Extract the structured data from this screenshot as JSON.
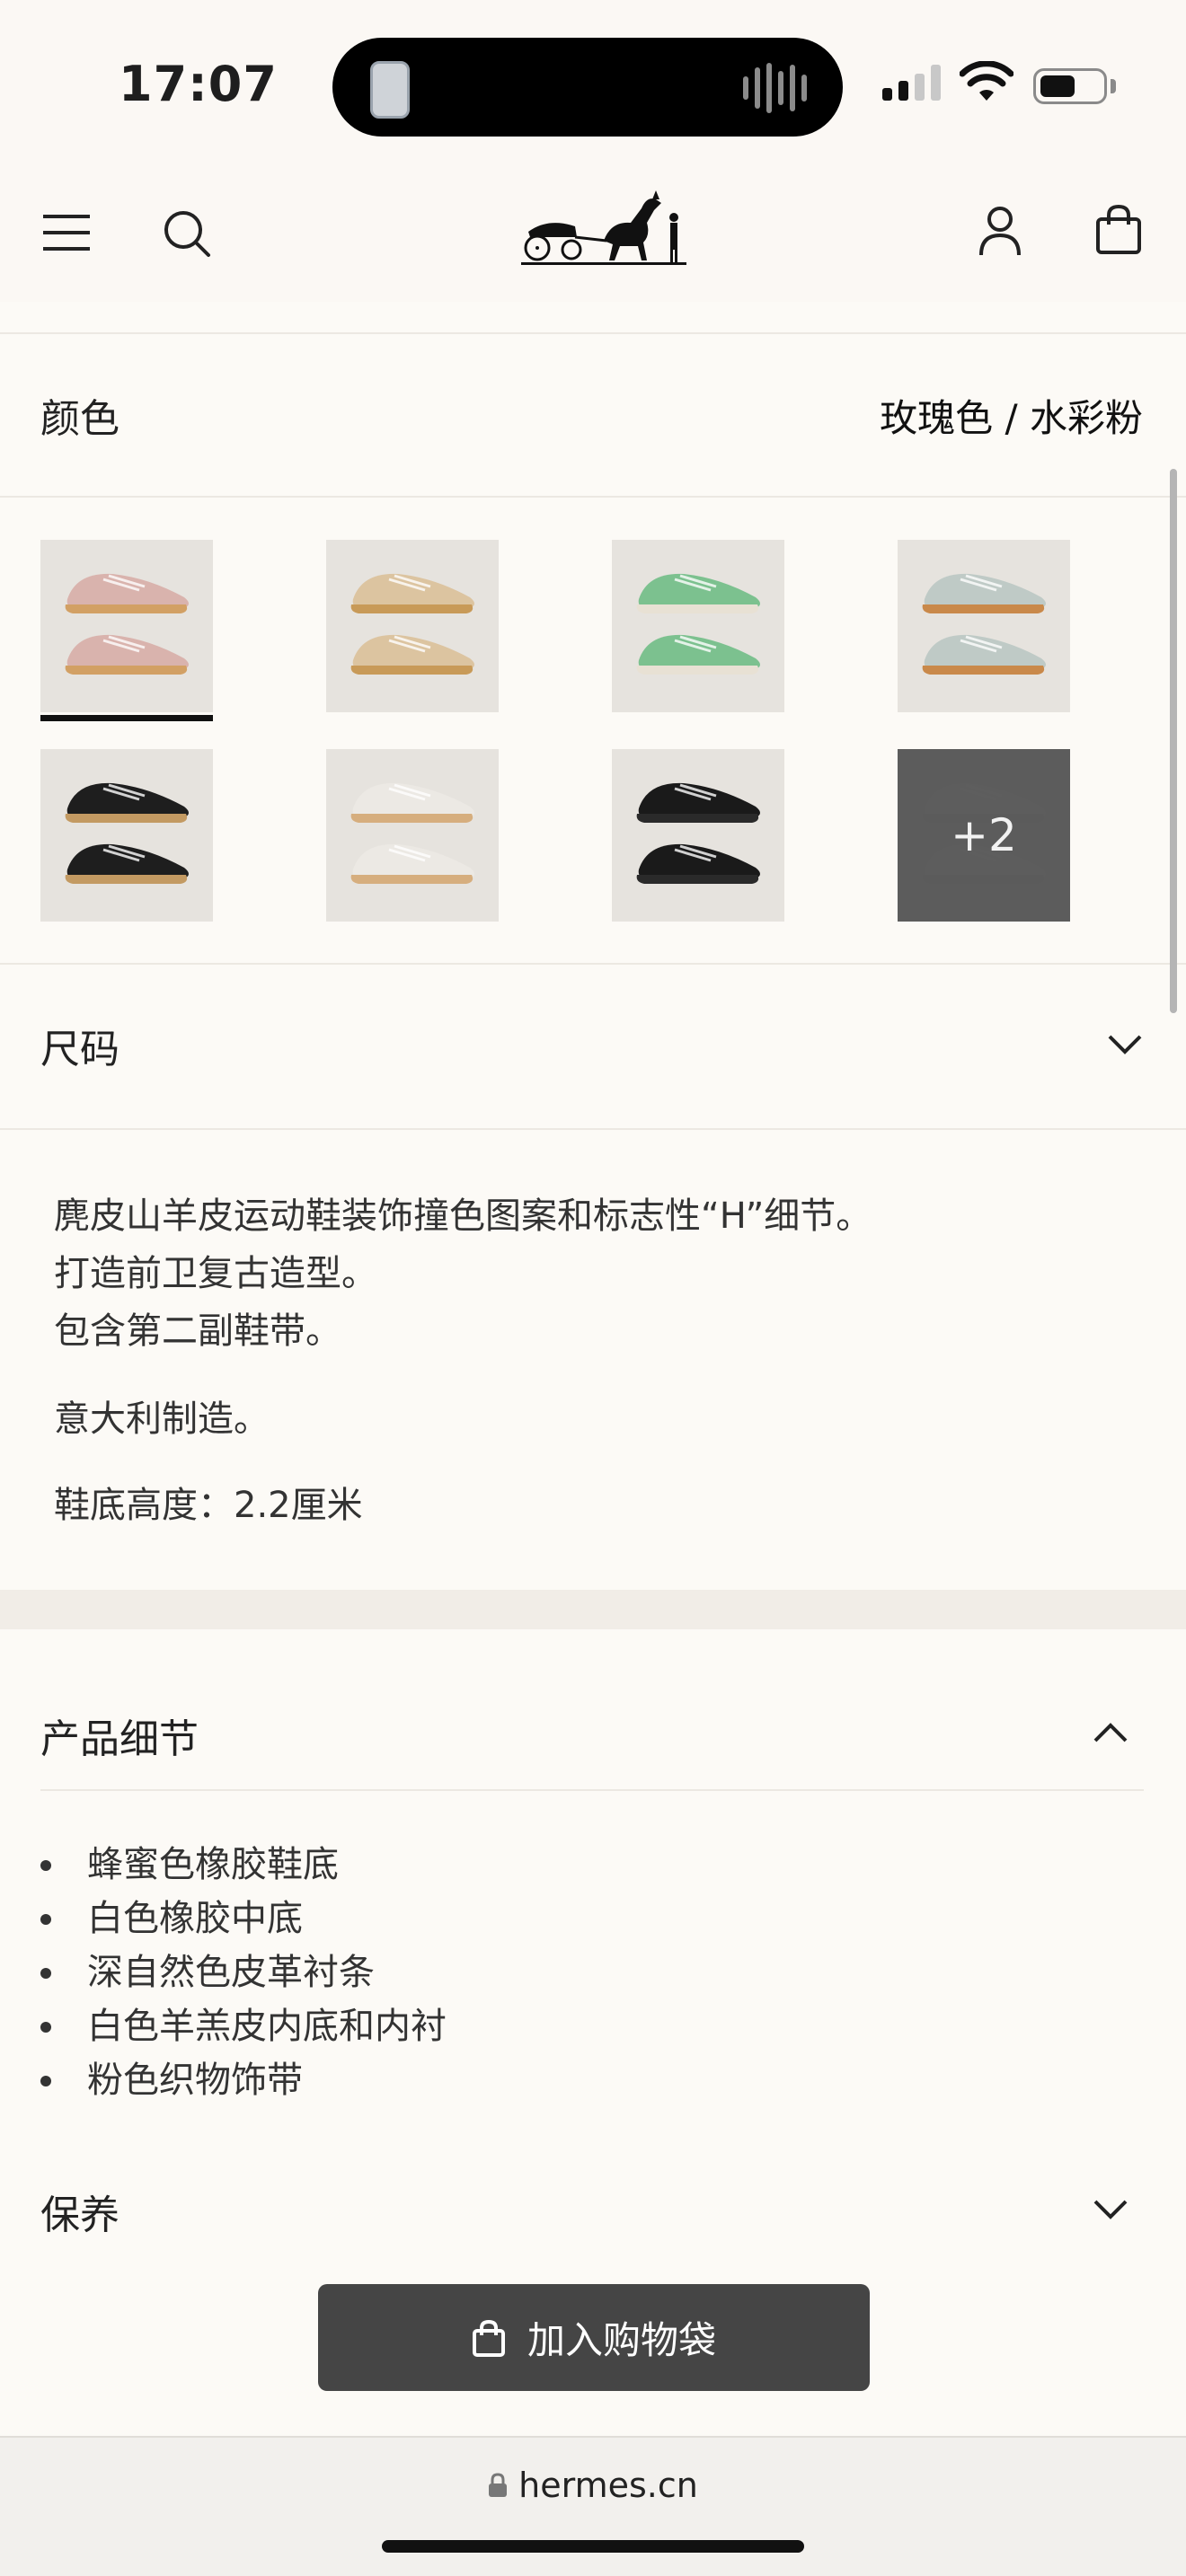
{
  "status_bar": {
    "time": "17:07"
  },
  "header": {
    "menu_icon": "hamburger-menu-icon",
    "search_icon": "search-icon",
    "logo": "hermes-carriage-logo",
    "account_icon": "account-icon",
    "bag_icon": "shopping-bag-icon"
  },
  "color": {
    "label": "颜色",
    "selected_value": "玫瑰色 / 水彩粉",
    "more_count": "+2",
    "swatches": [
      {
        "name": "rose",
        "upper": "#d9b3ad",
        "sole": "#d2a064"
      },
      {
        "name": "beige",
        "upper": "#dcc4a0",
        "sole": "#c89a58"
      },
      {
        "name": "green",
        "upper": "#7cc18f",
        "sole": "#e8e1d4"
      },
      {
        "name": "grey-green",
        "upper": "#bfcac6",
        "sole": "#c9894a"
      },
      {
        "name": "black",
        "upper": "#1e1e1e",
        "sole": "#c39a62"
      },
      {
        "name": "white",
        "upper": "#ece9e4",
        "sole": "#d6ae7e"
      },
      {
        "name": "black-black",
        "upper": "#1a1a1a",
        "sole": "#2a2a2a"
      },
      {
        "name": "more",
        "upper": "#e9e9e9",
        "sole": "#d9d9d9"
      }
    ]
  },
  "size": {
    "label": "尺码"
  },
  "description": {
    "lines": [
      "麂皮山羊皮运动鞋装饰撞色图案和标志性“H”细节。",
      "打造前卫复古造型。",
      "包含第二副鞋带。"
    ],
    "made_in": "意大利制造。",
    "sole_height": "鞋底高度：2.2厘米"
  },
  "product_details": {
    "title": "产品细节",
    "items": [
      "蜂蜜色橡胶鞋底",
      "白色橡胶中底",
      "深自然色皮革衬条",
      "白色羊羔皮内底和内衬",
      "粉色织物饰带"
    ]
  },
  "care": {
    "title": "保养"
  },
  "cta": {
    "add_to_bag": "加入购物袋"
  },
  "browser": {
    "url": "hermes.cn"
  }
}
